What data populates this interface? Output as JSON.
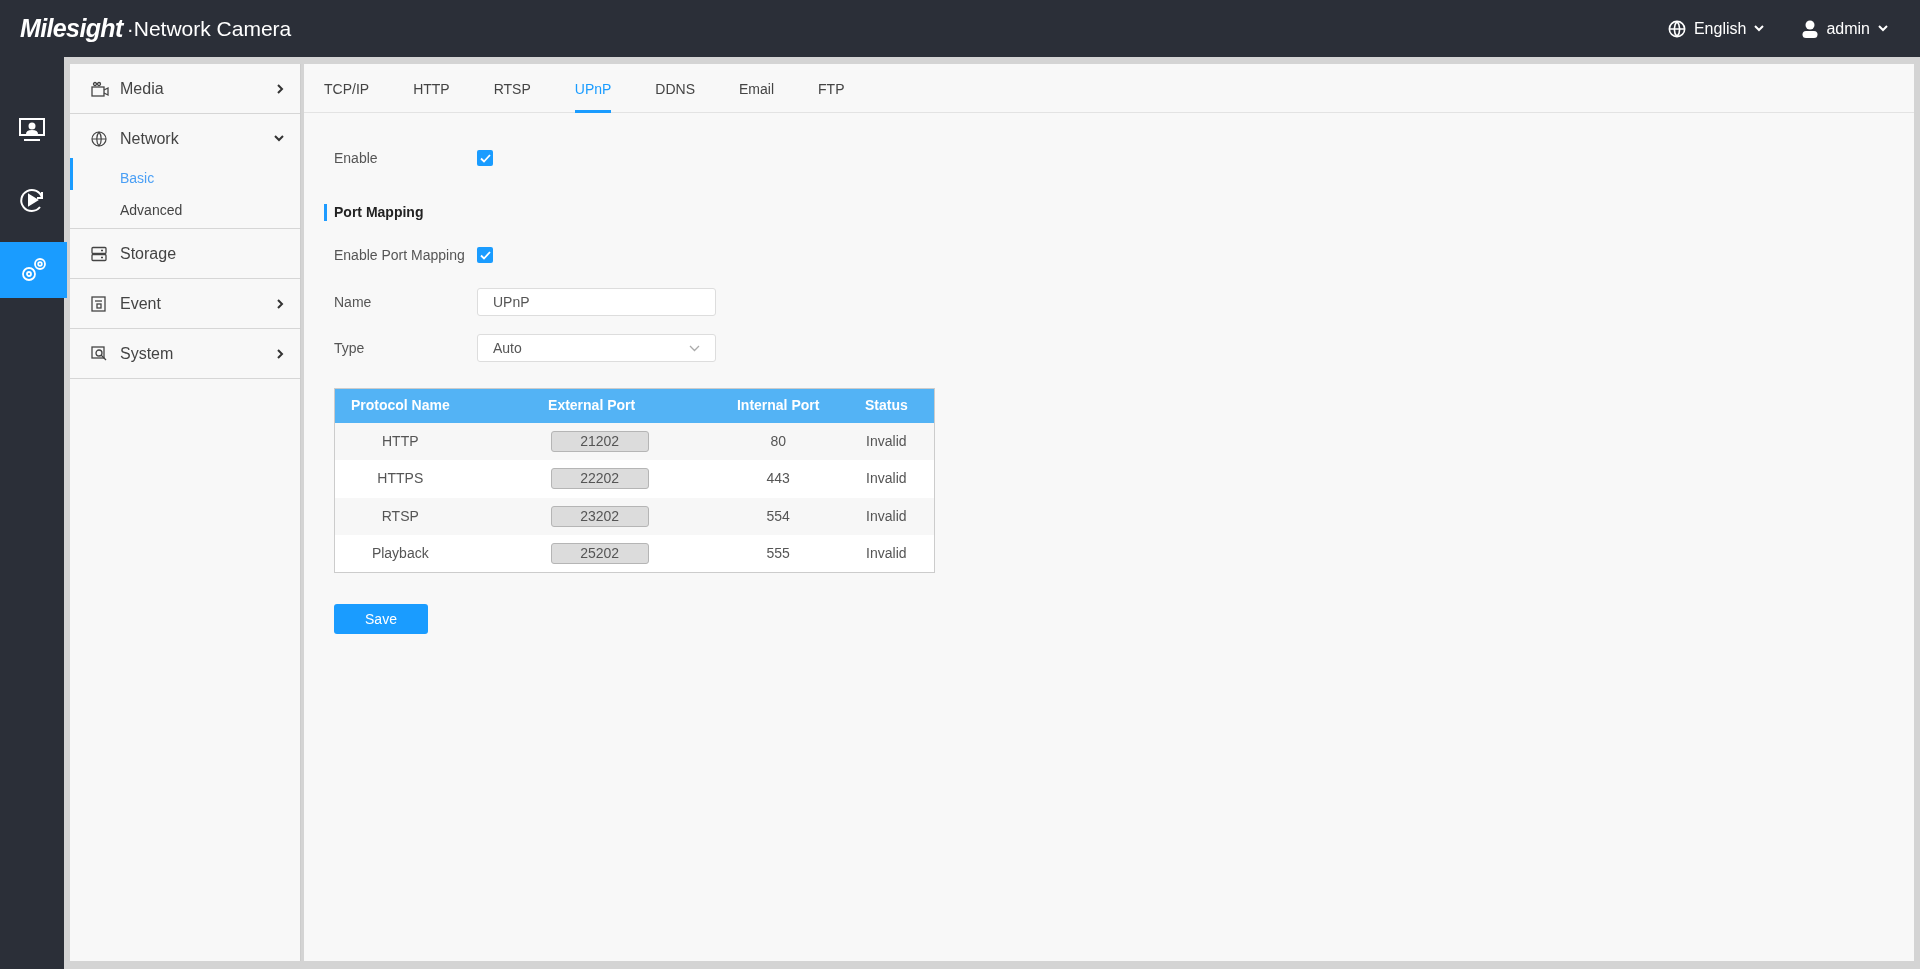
{
  "header": {
    "brand": "Milesight",
    "product": "·Network Camera",
    "language": "English",
    "user": "admin"
  },
  "rail": [
    {
      "selected": false
    },
    {
      "selected": false
    },
    {
      "selected": true
    }
  ],
  "sidebar": {
    "items": [
      {
        "label": "Media",
        "expanded": false
      },
      {
        "label": "Network",
        "expanded": true,
        "children": [
          {
            "label": "Basic",
            "selected": true
          },
          {
            "label": "Advanced",
            "selected": false
          }
        ]
      },
      {
        "label": "Storage"
      },
      {
        "label": "Event",
        "expanded": false
      },
      {
        "label": "System",
        "expanded": false
      }
    ]
  },
  "tabs": [
    {
      "label": "TCP/IP",
      "selected": false
    },
    {
      "label": "HTTP",
      "selected": false
    },
    {
      "label": "RTSP",
      "selected": false
    },
    {
      "label": "UPnP",
      "selected": true
    },
    {
      "label": "DDNS",
      "selected": false
    },
    {
      "label": "Email",
      "selected": false
    },
    {
      "label": "FTP",
      "selected": false
    }
  ],
  "form": {
    "enable": {
      "label": "Enable",
      "checked": true
    },
    "section_title": "Port Mapping",
    "enable_port_mapping": {
      "label": "Enable Port Mapping",
      "checked": true
    },
    "name": {
      "label": "Name",
      "value": "UPnP"
    },
    "type": {
      "label": "Type",
      "value": "Auto"
    }
  },
  "table": {
    "columns": [
      "Protocol Name",
      "External Port",
      "Internal Port",
      "Status"
    ],
    "rows": [
      {
        "protocol": "HTTP",
        "external_port": "21202",
        "internal_port": "80",
        "status": "Invalid"
      },
      {
        "protocol": "HTTPS",
        "external_port": "22202",
        "internal_port": "443",
        "status": "Invalid"
      },
      {
        "protocol": "RTSP",
        "external_port": "23202",
        "internal_port": "554",
        "status": "Invalid"
      },
      {
        "protocol": "Playback",
        "external_port": "25202",
        "internal_port": "555",
        "status": "Invalid"
      }
    ]
  },
  "save_button": "Save"
}
